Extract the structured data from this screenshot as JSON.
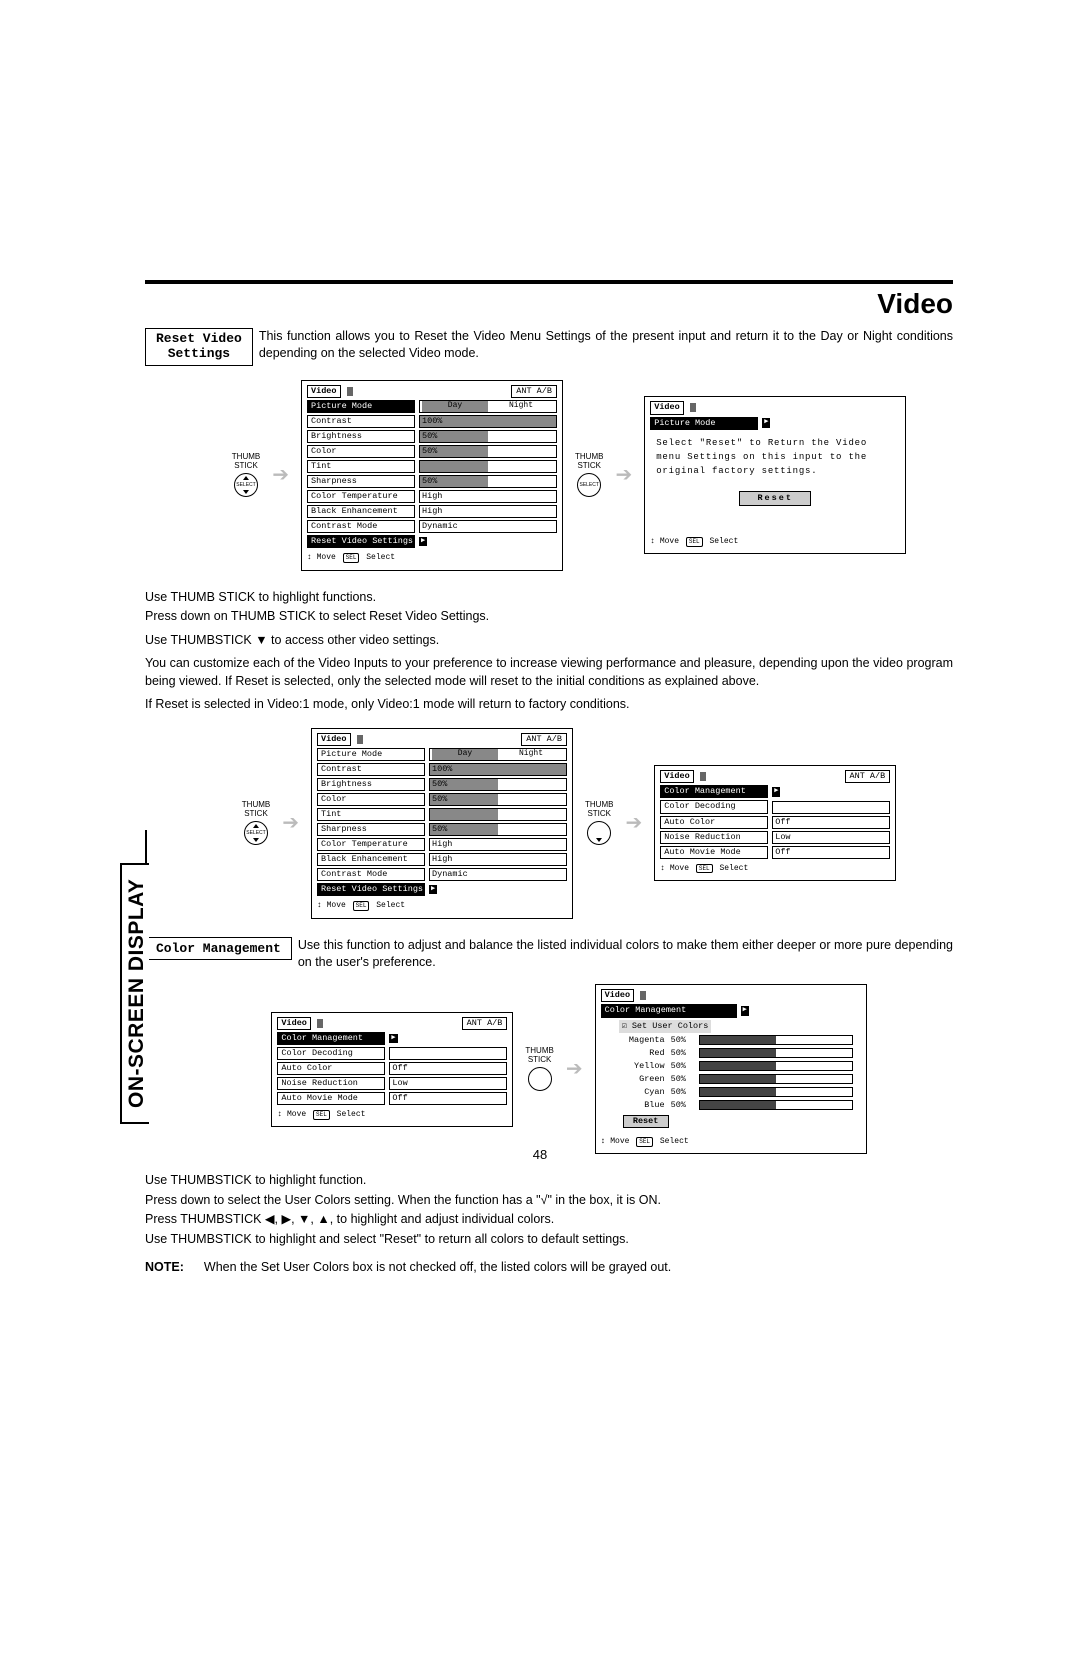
{
  "title": "Video",
  "side_tab": "ON-SCREEN DISPLAY",
  "page_number": "48",
  "thumb_label_1": "THUMB",
  "thumb_label_2": "STICK",
  "arrow": "➔",
  "section_reset": {
    "label_line1": "Reset Video",
    "label_line2": "Settings",
    "desc": "This function allows you to Reset the Video Menu Settings of the present input and return it to the Day or Night conditions depending on the selected Video mode."
  },
  "instructions_reset": [
    "Use THUMB STICK to highlight functions.",
    "Press down on THUMB STICK to select Reset Video Settings.",
    "",
    "Use THUMBSTICK ▼ to access other video settings.",
    "",
    "You can customize each of the Video Inputs to your preference to increase viewing performance and pleasure, depending upon the video program being viewed. If Reset is selected, only the selected mode will reset to the initial conditions as explained above.",
    "",
    "If Reset is selected in Video:1 mode, only Video:1 mode will return to factory conditions."
  ],
  "section_color": {
    "label": "Color Management",
    "desc": "Use this function to adjust and balance the listed individual colors to make them either deeper or more pure depending on the user's preference."
  },
  "instructions_color": [
    "Use THUMBSTICK to highlight function.",
    "Press down to select the User Colors setting.  When the function has a \"√\" in the box, it is ON.",
    "Press THUMBSTICK ◀, ▶, ▼, ▲, to highlight and adjust individual colors.",
    "Use THUMBSTICK to highlight and select \"Reset\" to return all colors to default settings."
  ],
  "note_label": "NOTE:",
  "note_text": "When the Set User Colors box is not checked off, the listed colors will be grayed out.",
  "osd_generic": {
    "title": "Video",
    "ant": "ANT A/B",
    "tab_day": "Day",
    "tab_night": "Night",
    "foot_move": "Move",
    "foot_select": "Select",
    "sel": "SEL"
  },
  "menu_video_full": [
    {
      "name": "Picture Mode",
      "type": "tabs"
    },
    {
      "name": "Contrast",
      "val": "100%",
      "bar": 1.0
    },
    {
      "name": "Brightness",
      "val": "50%",
      "bar": 0.5
    },
    {
      "name": "Color",
      "val": "50%",
      "bar": 0.5
    },
    {
      "name": "Tint",
      "val": "",
      "bar": 0.5
    },
    {
      "name": "Sharpness",
      "val": "50%",
      "bar": 0.5
    },
    {
      "name": "Color Temperature",
      "val": "High"
    },
    {
      "name": "Black Enhancement",
      "val": "High"
    },
    {
      "name": "Contrast Mode",
      "val": "Dynamic"
    },
    {
      "name": "Reset Video Settings",
      "go": true
    }
  ],
  "reset_msg": {
    "picture_mode": "Picture Mode",
    "text": "Select \"Reset\" to Return the Video menu Settings on this input to the original factory settings.",
    "btn": "Reset"
  },
  "menu_video_cm": [
    {
      "name": "Color Management",
      "go": true
    },
    {
      "name": "Color Decoding",
      "val": ""
    },
    {
      "name": "Auto Color",
      "val": "Off"
    },
    {
      "name": "Noise Reduction",
      "val": "Low"
    },
    {
      "name": "Auto Movie Mode",
      "val": "Off"
    }
  ],
  "colors": {
    "panel_title": "☑ Set User Colors",
    "reset": "Reset",
    "list": [
      {
        "name": "Magenta",
        "val": "50%",
        "bar": 0.5
      },
      {
        "name": "Red",
        "val": "50%",
        "bar": 0.5
      },
      {
        "name": "Yellow",
        "val": "50%",
        "bar": 0.5
      },
      {
        "name": "Green",
        "val": "50%",
        "bar": 0.5
      },
      {
        "name": "Cyan",
        "val": "50%",
        "bar": 0.5
      },
      {
        "name": "Blue",
        "val": "50%",
        "bar": 0.5
      }
    ]
  }
}
